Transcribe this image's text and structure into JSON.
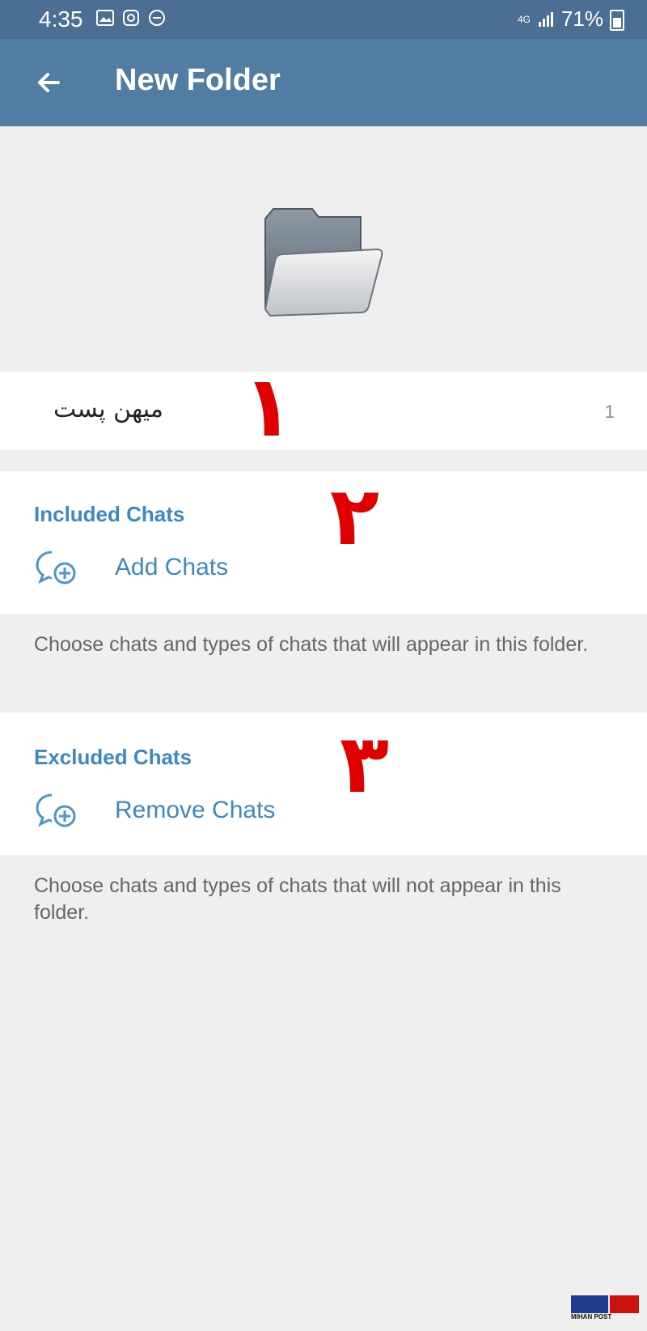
{
  "status_bar": {
    "time": "4:35",
    "network": "4G",
    "battery": "71%"
  },
  "header": {
    "title": "New Folder"
  },
  "folder_name": {
    "value": "میهن پست",
    "count": "1"
  },
  "annotations": [
    "۱",
    "۲",
    "۳"
  ],
  "included": {
    "title": "Included Chats",
    "action": "Add Chats",
    "hint": "Choose chats and types of chats that will appear in this folder."
  },
  "excluded": {
    "title": "Excluded Chats",
    "action": "Remove Chats",
    "hint": "Choose chats and types of chats that will not appear in this folder."
  },
  "watermark": {
    "text": "MIHAN POST"
  },
  "colors": {
    "header": "#527da3",
    "accent": "#3d88bf",
    "annotation": "#e00000"
  }
}
